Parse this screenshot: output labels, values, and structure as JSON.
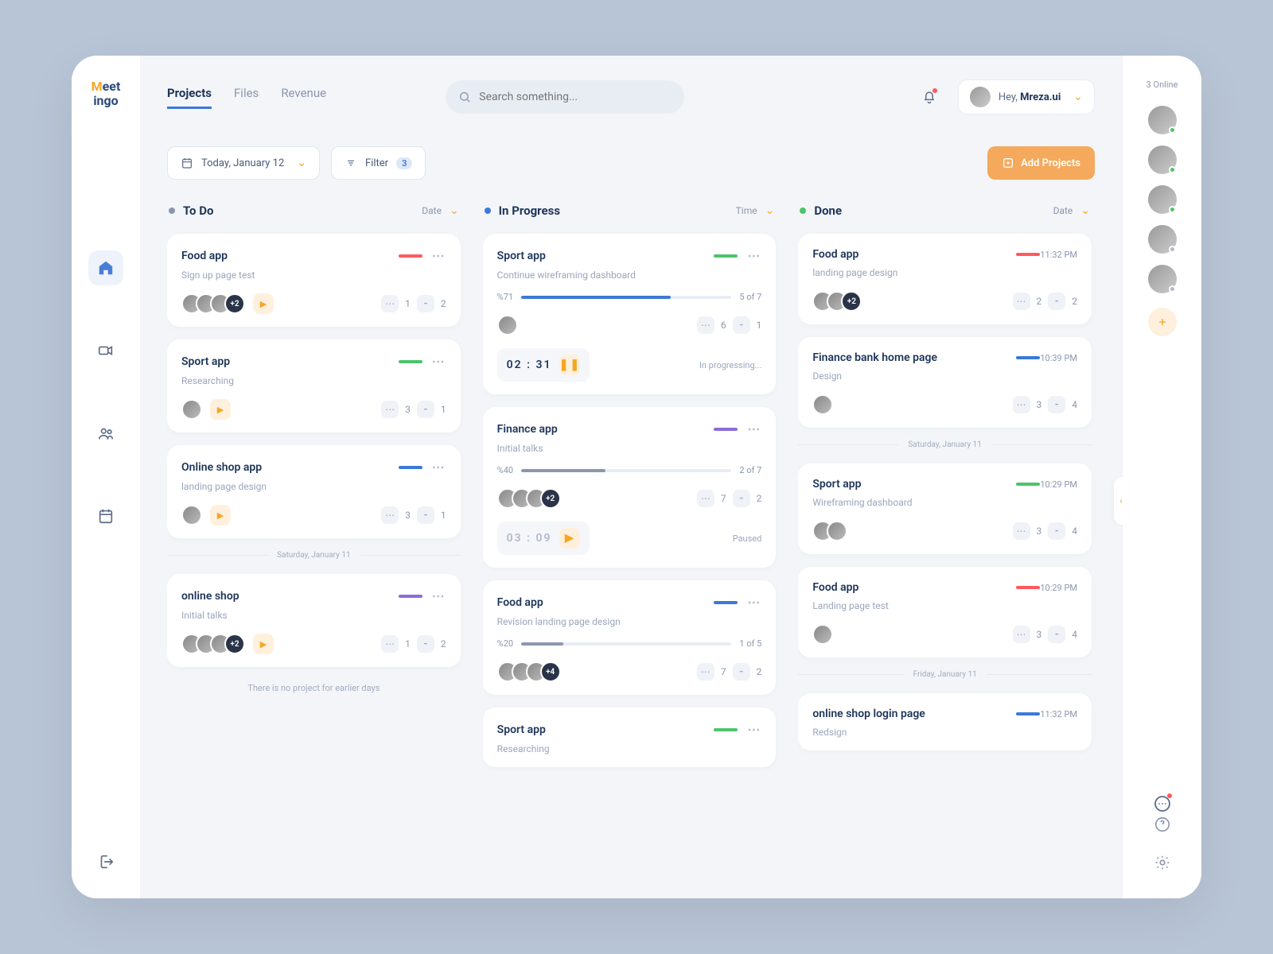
{
  "brand": {
    "m": "M",
    "eet": "eet",
    "ingo": "ingo"
  },
  "tabs": [
    "Projects",
    "Files",
    "Revenue"
  ],
  "search_placeholder": "Search something...",
  "user_greeting_prefix": "Hey, ",
  "user_name": "Mreza.ui",
  "date_picker": "Today, January 12",
  "filter_label": "Filter",
  "filter_count": "3",
  "add_btn": "Add Projects",
  "columns": {
    "todo": {
      "title": "To Do",
      "sort": "Date"
    },
    "progress": {
      "title": "In Progress",
      "sort": "Time"
    },
    "done": {
      "title": "Done",
      "sort": "Date"
    }
  },
  "todo_cards": [
    {
      "title": "Food app",
      "sub": "Sign up page test",
      "tag": "c-red",
      "avatars": 3,
      "plus": "+2",
      "c": "1",
      "a": "2"
    },
    {
      "title": "Sport app",
      "sub": "Researching",
      "tag": "c-green",
      "avatars": 1,
      "plus": null,
      "c": "3",
      "a": "1"
    },
    {
      "title": "Online shop app",
      "sub": "landing page design",
      "tag": "c-blue",
      "avatars": 1,
      "plus": null,
      "c": "3",
      "a": "1"
    }
  ],
  "todo_div": "Saturday, January 11",
  "todo_cards2": [
    {
      "title": "online shop",
      "sub": "Initial talks",
      "tag": "c-purple",
      "avatars": 3,
      "plus": "+2",
      "c": "1",
      "a": "2"
    }
  ],
  "todo_empty": "There is no project for earlier days",
  "prog_cards": [
    {
      "title": "Sport app",
      "sub": "Continue wireframing dashboard",
      "tag": "c-green",
      "pct": "%71",
      "pctv": 71,
      "frac": "5 of 7",
      "c": "6",
      "a": "1",
      "timer": "02 : 31",
      "state": "In progressing...",
      "btn": "pause"
    },
    {
      "title": "Finance app",
      "sub": "Initial talks",
      "tag": "c-purple",
      "pct": "%40",
      "pctv": 40,
      "frac": "2 of 7",
      "avatars": 3,
      "plus": "+2",
      "c": "7",
      "a": "2",
      "timer": "03 : 09",
      "state": "Paused",
      "btn": "play",
      "muted": true
    },
    {
      "title": "Food app",
      "sub": "Revision landing page design",
      "tag": "c-blue",
      "pct": "%20",
      "pctv": 20,
      "frac": "1 of 5",
      "avatars": 3,
      "plus": "+4",
      "c": "7",
      "a": "2"
    },
    {
      "title": "Sport app",
      "sub": "Researching",
      "tag": "c-green"
    }
  ],
  "done_cards": [
    {
      "title": "Food app",
      "sub": "landing page design",
      "tag": "c-red",
      "time": "11:32 PM",
      "avatars": 2,
      "plus": "+2",
      "c": "2",
      "a": "2"
    },
    {
      "title": "Finance bank home page",
      "sub": "Design",
      "tag": "c-blue",
      "time": "10:39 PM",
      "avatars": 1,
      "c": "3",
      "a": "4"
    }
  ],
  "done_div1": "Saturday, January 11",
  "done_cards2": [
    {
      "title": "Sport app",
      "sub": "Wireframing dashboard",
      "tag": "c-green",
      "time": "10:29 PM",
      "avatars": 2,
      "c": "3",
      "a": "4"
    },
    {
      "title": "Food app",
      "sub": "Landing page test",
      "tag": "c-red",
      "time": "10:29 PM",
      "avatars": 1,
      "c": "3",
      "a": "4"
    }
  ],
  "done_div2": "Friday, January 11",
  "done_cards3": [
    {
      "title": "online shop login page",
      "sub": "Redsign",
      "tag": "c-blue",
      "time": "11:32 PM"
    }
  ],
  "online_label": "3 Online",
  "presence_dots": [
    "#4cc36b",
    "#4cc36b",
    "#4cc36b",
    "#b0bacb",
    "#b0bacb"
  ]
}
